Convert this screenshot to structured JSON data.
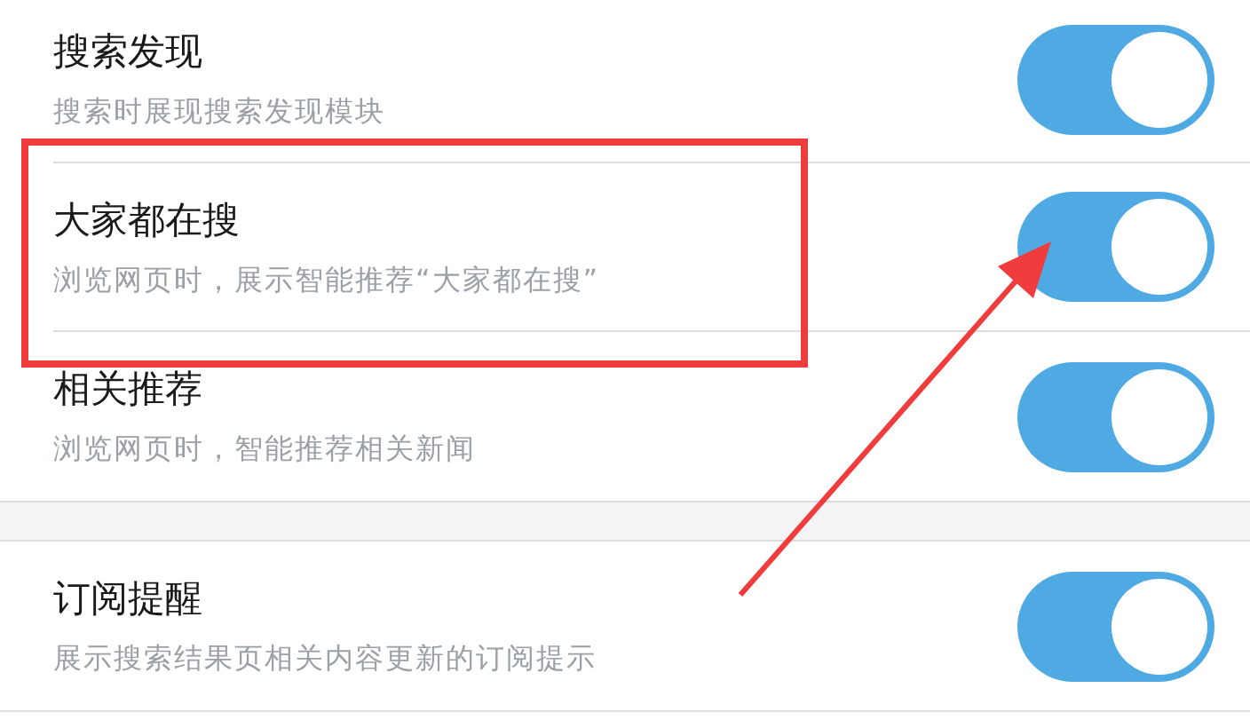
{
  "groups": [
    {
      "items": [
        {
          "title": "搜索发现",
          "description": "搜索时展现搜索发现模块",
          "on": true
        },
        {
          "title": "大家都在搜",
          "description": "浏览网页时，展示智能推荐“大家都在搜”",
          "on": true
        },
        {
          "title": "相关推荐",
          "description": "浏览网页时，智能推荐相关新闻",
          "on": true
        }
      ]
    },
    {
      "items": [
        {
          "title": "订阅提醒",
          "description": "展示搜索结果页相关内容更新的订阅提示",
          "on": true
        }
      ]
    }
  ]
}
